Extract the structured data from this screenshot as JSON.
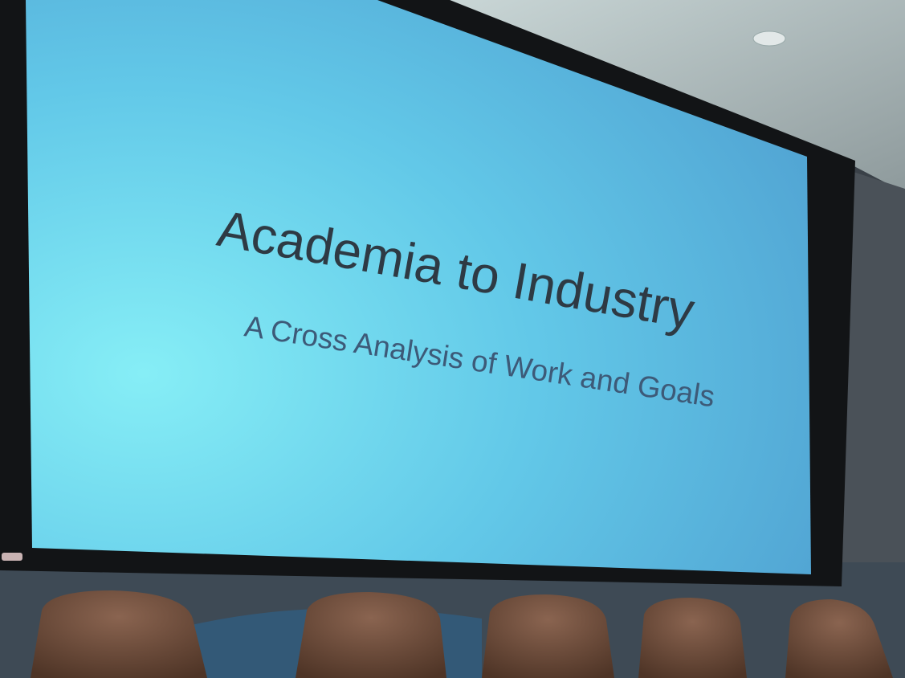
{
  "slide": {
    "title": "Academia to Industry",
    "subtitle": "A Cross Analysis of Work and Goals"
  },
  "colors": {
    "screen_light": "#7fe3f2",
    "screen_mid": "#5cc2e6",
    "screen_dark": "#4aa3cc",
    "title_text": "#2e3a44",
    "subtitle_text": "#3d5a78",
    "chair": "#6b4a38"
  }
}
